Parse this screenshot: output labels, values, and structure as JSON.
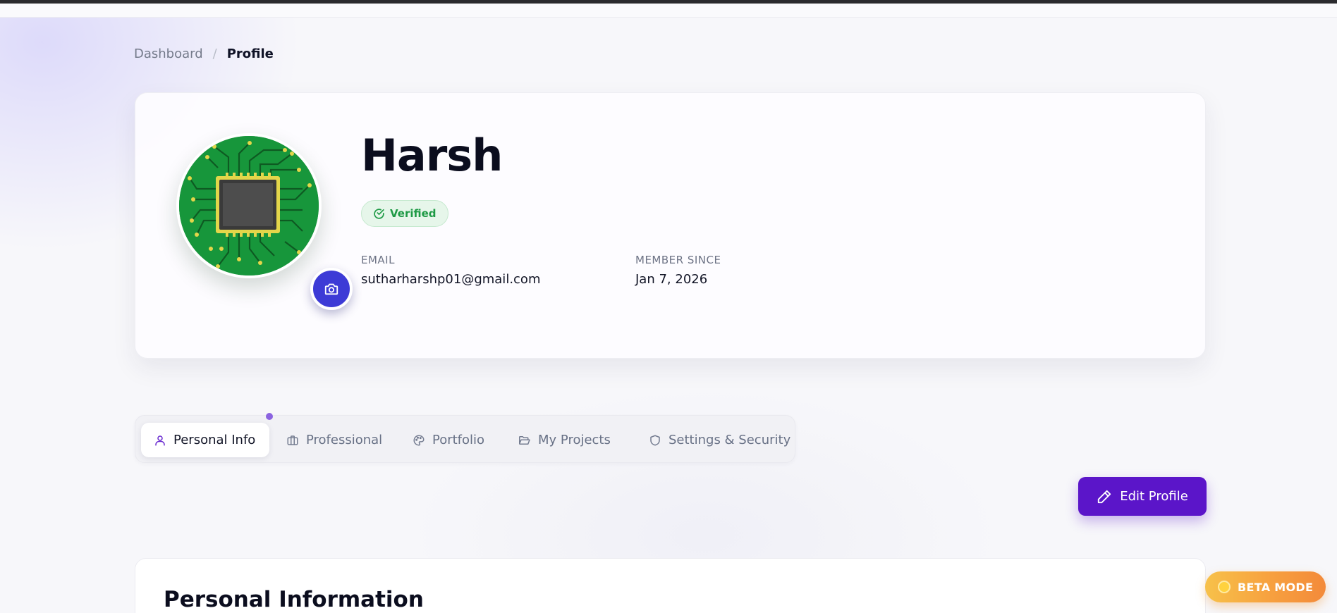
{
  "breadcrumb": {
    "parent": "Dashboard",
    "separator": "/",
    "current": "Profile"
  },
  "profile": {
    "name": "Harsh",
    "verified_label": "Verified",
    "email_label": "EMAIL",
    "email_value": "sutharharshp01@gmail.com",
    "member_since_label": "MEMBER SINCE",
    "member_since_value": "Jan 7, 2026"
  },
  "tabs": [
    {
      "label": "Personal Info",
      "icon": "user-icon",
      "active": true
    },
    {
      "label": "Professional",
      "icon": "briefcase-icon",
      "active": false
    },
    {
      "label": "Portfolio",
      "icon": "palette-icon",
      "active": false
    },
    {
      "label": "My Projects",
      "icon": "folder-open-icon",
      "active": false
    },
    {
      "label": "Settings & Security",
      "icon": "shield-icon",
      "active": false
    }
  ],
  "actions": {
    "edit_profile_label": "Edit Profile"
  },
  "section": {
    "title": "Personal Information"
  },
  "beta": {
    "label": "BETA MODE"
  },
  "colors": {
    "accent": "#5b15c9",
    "camera": "#3d3bd6",
    "verified": "#1e9a45",
    "beta": "#f7a03f"
  }
}
